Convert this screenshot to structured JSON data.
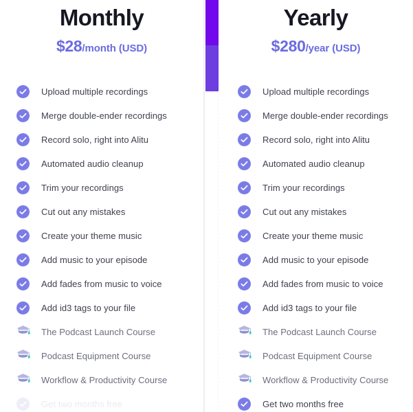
{
  "colors": {
    "accent_purple": "#7b7be8",
    "price_purple": "#6b6be0",
    "scroll_top": "#7209ed",
    "scroll_bottom": "#6d3ee0",
    "title_dark": "#161722",
    "text_gray": "#3f4150",
    "cap_purple": "#8f8fd6",
    "cap_teal": "#3dcfb6",
    "divider": "#ededf0"
  },
  "plans": [
    {
      "name": "Monthly",
      "price_amount": "$28",
      "price_period": "/month (USD)",
      "features": [
        {
          "label": "Upload multiple recordings",
          "icon": "check-circle-icon",
          "state": "included"
        },
        {
          "label": "Merge double-ender recordings",
          "icon": "check-circle-icon",
          "state": "included"
        },
        {
          "label": "Record solo, right into Alitu",
          "icon": "check-circle-icon",
          "state": "included"
        },
        {
          "label": "Automated audio cleanup",
          "icon": "check-circle-icon",
          "state": "included"
        },
        {
          "label": "Trim your recordings",
          "icon": "check-circle-icon",
          "state": "included"
        },
        {
          "label": "Cut out any mistakes",
          "icon": "check-circle-icon",
          "state": "included"
        },
        {
          "label": "Create your theme music",
          "icon": "check-circle-icon",
          "state": "included"
        },
        {
          "label": "Add music to your episode",
          "icon": "check-circle-icon",
          "state": "included"
        },
        {
          "label": "Add fades from music to voice",
          "icon": "check-circle-icon",
          "state": "included"
        },
        {
          "label": "Add id3 tags to your file",
          "icon": "check-circle-icon",
          "state": "included"
        },
        {
          "label": "The Podcast Launch Course",
          "icon": "graduation-cap-icon",
          "state": "course"
        },
        {
          "label": "Podcast Equipment Course",
          "icon": "graduation-cap-icon",
          "state": "course"
        },
        {
          "label": "Workflow & Productivity Course",
          "icon": "graduation-cap-icon",
          "state": "course"
        },
        {
          "label": "Get two months free",
          "icon": "check-circle-icon",
          "state": "disabled"
        }
      ]
    },
    {
      "name": "Yearly",
      "price_amount": "$280",
      "price_period": "/year (USD)",
      "features": [
        {
          "label": "Upload multiple recordings",
          "icon": "check-circle-icon",
          "state": "included"
        },
        {
          "label": "Merge double-ender recordings",
          "icon": "check-circle-icon",
          "state": "included"
        },
        {
          "label": "Record solo, right into Alitu",
          "icon": "check-circle-icon",
          "state": "included"
        },
        {
          "label": "Automated audio cleanup",
          "icon": "check-circle-icon",
          "state": "included"
        },
        {
          "label": "Trim your recordings",
          "icon": "check-circle-icon",
          "state": "included"
        },
        {
          "label": "Cut out any mistakes",
          "icon": "check-circle-icon",
          "state": "included"
        },
        {
          "label": "Create your theme music",
          "icon": "check-circle-icon",
          "state": "included"
        },
        {
          "label": "Add music to your episode",
          "icon": "check-circle-icon",
          "state": "included"
        },
        {
          "label": "Add fades from music to voice",
          "icon": "check-circle-icon",
          "state": "included"
        },
        {
          "label": "Add id3 tags to your file",
          "icon": "check-circle-icon",
          "state": "included"
        },
        {
          "label": "The Podcast Launch Course",
          "icon": "graduation-cap-icon",
          "state": "course"
        },
        {
          "label": "Podcast Equipment Course",
          "icon": "graduation-cap-icon",
          "state": "course"
        },
        {
          "label": "Workflow & Productivity Course",
          "icon": "graduation-cap-icon",
          "state": "course"
        },
        {
          "label": "Get two months free",
          "icon": "check-circle-icon",
          "state": "included"
        }
      ]
    }
  ]
}
